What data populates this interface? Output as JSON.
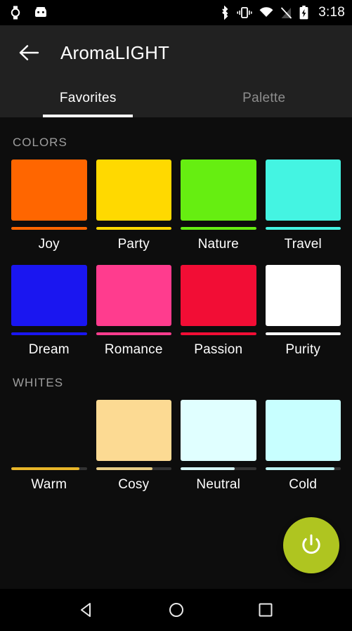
{
  "statusbar": {
    "left_icons": [
      {
        "name": "watch-icon"
      },
      {
        "name": "android-head-icon"
      }
    ],
    "right_icons": [
      {
        "name": "bluetooth-icon"
      },
      {
        "name": "vibrate-icon"
      },
      {
        "name": "wifi-icon"
      },
      {
        "name": "no-signal-icon"
      },
      {
        "name": "battery-charging-icon"
      }
    ],
    "clock": "3:18"
  },
  "appbar": {
    "back_icon": "arrow-back-icon",
    "title": "AromaLIGHT",
    "background": "#212121",
    "tabs": [
      {
        "label": "Favorites",
        "active": true
      },
      {
        "label": "Palette",
        "active": false
      }
    ]
  },
  "content": {
    "sections": [
      {
        "header": "COLORS",
        "swatches": [
          {
            "label": "Joy",
            "color": "#FF6600",
            "slider_color": "#FF6600",
            "brightness": 100
          },
          {
            "label": "Party",
            "color": "#FFD900",
            "slider_color": "#FFD900",
            "brightness": 100
          },
          {
            "label": "Nature",
            "color": "#66EE11",
            "slider_color": "#66EE11",
            "brightness": 100
          },
          {
            "label": "Travel",
            "color": "#44F4E2",
            "slider_color": "#44F4E2",
            "brightness": 100
          }
        ]
      },
      {
        "header": "",
        "swatches": [
          {
            "label": "Dream",
            "color": "#1A16F0",
            "slider_color": "#1A16F0",
            "brightness": 100
          },
          {
            "label": "Romance",
            "color": "#FF3C8E",
            "slider_color": "#FF3C8E",
            "brightness": 100
          },
          {
            "label": "Passion",
            "color": "#F20D35",
            "slider_color": "#F20D35",
            "brightness": 100
          },
          {
            "label": "Purity",
            "color": "#FFFFFF",
            "slider_color": "#FFFFFF",
            "brightness": 100
          }
        ]
      },
      {
        "header": "WHITES",
        "swatches": [
          {
            "label": "Warm",
            "color": "#FBC githubC33",
            "slider_color": "#E8B629",
            "brightness": 90
          },
          {
            "label": "Cosy",
            "color": "#FCDA93",
            "slider_color": "#E8CD86",
            "brightness": 75
          },
          {
            "label": "Neutral",
            "color": "#E0FFFF",
            "slider_color": "#D6F4F4",
            "brightness": 72
          },
          {
            "label": "Cold",
            "color": "#C8FFFF",
            "slider_color": "#BFF5F5",
            "brightness": 92
          }
        ]
      }
    ]
  },
  "fab": {
    "icon": "power-icon",
    "color": "#AFC520",
    "label": "Power"
  },
  "navbar": {
    "buttons": [
      {
        "name": "nav-back-button"
      },
      {
        "name": "nav-home-button"
      },
      {
        "name": "nav-recents-button"
      }
    ]
  }
}
